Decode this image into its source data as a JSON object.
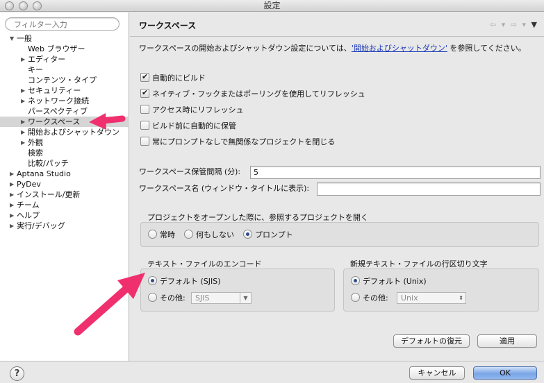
{
  "window": {
    "title": "設定"
  },
  "sidebar": {
    "filter_placeholder": "フィルター入力",
    "items": [
      {
        "label": "一般",
        "twisty": "▼",
        "level": 0
      },
      {
        "label": "Web ブラウザー",
        "twisty": "",
        "level": 1
      },
      {
        "label": "エディター",
        "twisty": "▶",
        "level": 1
      },
      {
        "label": "キー",
        "twisty": "",
        "level": 1
      },
      {
        "label": "コンテンツ・タイプ",
        "twisty": "",
        "level": 1
      },
      {
        "label": "セキュリティー",
        "twisty": "▶",
        "level": 1
      },
      {
        "label": "ネットワーク接続",
        "twisty": "▶",
        "level": 1
      },
      {
        "label": "パースペクティブ",
        "twisty": "",
        "level": 1
      },
      {
        "label": "ワークスペース",
        "twisty": "▶",
        "level": 1,
        "selected": true
      },
      {
        "label": "開始およびシャットダウン",
        "twisty": "▶",
        "level": 1
      },
      {
        "label": "外観",
        "twisty": "▶",
        "level": 1
      },
      {
        "label": "検索",
        "twisty": "",
        "level": 1
      },
      {
        "label": "比較/パッチ",
        "twisty": "",
        "level": 1
      },
      {
        "label": "Aptana Studio",
        "twisty": "▶",
        "level": 0
      },
      {
        "label": "PyDev",
        "twisty": "▶",
        "level": 0
      },
      {
        "label": "インストール/更新",
        "twisty": "▶",
        "level": 0
      },
      {
        "label": "チーム",
        "twisty": "▶",
        "level": 0
      },
      {
        "label": "ヘルプ",
        "twisty": "▶",
        "level": 0
      },
      {
        "label": "実行/デバッグ",
        "twisty": "▶",
        "level": 0
      }
    ]
  },
  "main": {
    "title": "ワークスペース",
    "nav": {
      "back": "⇦ ▾",
      "forward": "⇨ ▾",
      "menu": "▼"
    },
    "desc_prefix": "ワークスペースの開始およびシャットダウン設定については、",
    "desc_link": "'開始およびシャットダウン'",
    "desc_suffix": " を参照してください。",
    "checkboxes": [
      {
        "label": "自動的にビルド",
        "checked": true
      },
      {
        "label": "ネイティブ・フックまたはポーリングを使用してリフレッシュ",
        "checked": true
      },
      {
        "label": "アクセス時にリフレッシュ",
        "checked": false
      },
      {
        "label": "ビルド前に自動的に保管",
        "checked": false
      },
      {
        "label": "常にプロンプトなしで無関係なプロジェクトを閉じる",
        "checked": false
      }
    ],
    "save_interval": {
      "label": "ワークスペース保管間隔 (分):",
      "value": "5"
    },
    "workspace_name": {
      "label": "ワークスペース名 (ウィンドウ・タイトルに表示):",
      "value": ""
    },
    "open_projects": {
      "title": "プロジェクトをオープンした際に、参照するプロジェクトを開く",
      "options": [
        {
          "label": "常時",
          "selected": false
        },
        {
          "label": "何もしない",
          "selected": false
        },
        {
          "label": "プロンプト",
          "selected": true
        }
      ]
    },
    "encoding": {
      "title": "テキスト・ファイルのエンコード",
      "default_label": "デフォルト (SJIS)",
      "default_selected": true,
      "other_label": "その他:",
      "other_value": "SJIS"
    },
    "line_delimiter": {
      "title": "新規テキスト・ファイルの行区切り文字",
      "default_label": "デフォルト (Unix)",
      "default_selected": true,
      "other_label": "その他:",
      "other_value": "Unix"
    },
    "restore_defaults_label": "デフォルトの復元",
    "apply_label": "適用"
  },
  "footer": {
    "help_glyph": "?",
    "cancel_label": "キャンセル",
    "ok_label": "OK"
  },
  "annotation_color": "#f0306e"
}
